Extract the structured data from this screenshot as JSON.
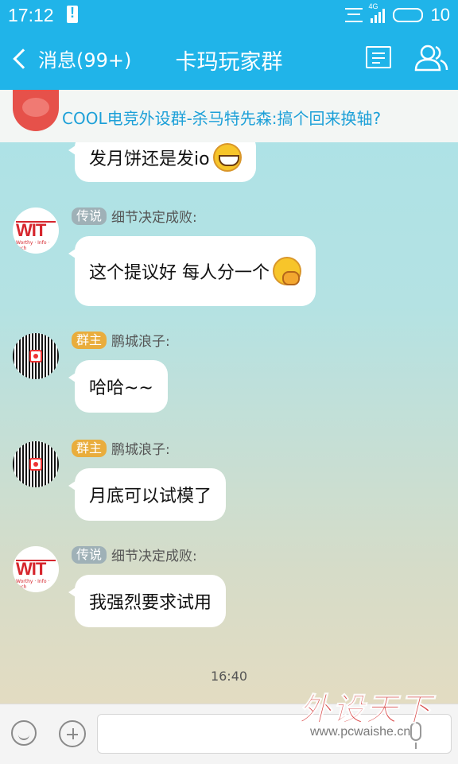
{
  "status_bar": {
    "time": "17:12",
    "network": "4G",
    "battery_level": "10"
  },
  "header": {
    "back_label": "消息(99+)",
    "title": "卡玛玩家群"
  },
  "pinned": {
    "text": "COOL电竞外设群-杀马特先森:搞个回来换轴?"
  },
  "messages": [
    {
      "text": "发月饼还是发io",
      "emoji": "grin-emoji"
    },
    {
      "badge": "传说",
      "sender": "细节决定成败:",
      "text": "这个提议好  每人分一个",
      "emoji": "shy-emoji",
      "avatar": "WIT",
      "avatar_sub": "Worthy · Info · Tech"
    },
    {
      "badge": "群主",
      "sender": "鹏城浪子:",
      "text": "哈哈~~",
      "avatar": "qr-code-avatar"
    },
    {
      "badge": "群主",
      "sender": "鹏城浪子:",
      "text": "月底可以试模了",
      "avatar": "qr-code-avatar"
    },
    {
      "badge": "传说",
      "sender": "细节决定成败:",
      "text": "我强烈要求试用",
      "avatar": "WIT",
      "avatar_sub": "Worthy · Info · Tech"
    }
  ],
  "timestamp": "16:40",
  "input": {
    "value": ""
  },
  "watermark": {
    "main": "外设天下",
    "sub": "www.pcwaishe.cn"
  },
  "colors": {
    "accent": "#20b4e9",
    "owner_badge": "#e9ad3d",
    "legend_badge": "#9fb1b7",
    "link": "#1da0d8"
  }
}
